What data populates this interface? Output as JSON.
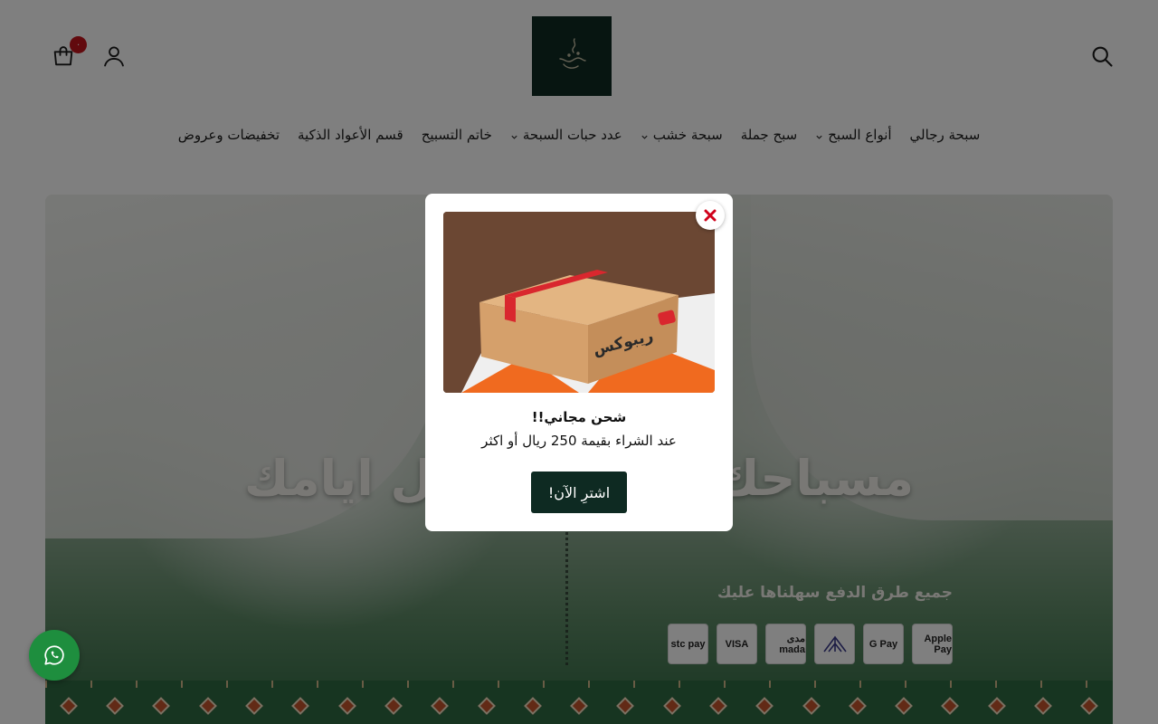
{
  "header": {
    "cart_count": "٠",
    "nav": [
      {
        "label": "سبحة رجالي",
        "dropdown": false
      },
      {
        "label": "أنواع السبح",
        "dropdown": true
      },
      {
        "label": "سبح جملة",
        "dropdown": false
      },
      {
        "label": "سبحة خشب",
        "dropdown": true
      },
      {
        "label": "عدد حبات السبحة",
        "dropdown": true
      },
      {
        "label": "خاتم التسبيح",
        "dropdown": false
      },
      {
        "label": "قسم الأعواد الذكية",
        "dropdown": false
      },
      {
        "label": "تخفيضات وعروض",
        "dropdown": false
      }
    ]
  },
  "hero": {
    "title": "مسباحك لكـــــــــــــل ايامك",
    "payments_text": "جميع طرق الدفع سهلناها عليك",
    "payment_methods": [
      "Apple Pay",
      "G Pay",
      "tabby",
      "مدى mada",
      "VISA",
      "stc pay"
    ]
  },
  "modal": {
    "image_brand": "ريبوكس",
    "title": "شحن مجاني!!",
    "text": "عند الشراء بقيمة 250 ريال أو اكثر",
    "cta": "اشترِ الآن!"
  },
  "colors": {
    "brand_dark": "#0e2a22",
    "badge_red": "#c4151c",
    "close_red": "#d0021b",
    "whatsapp_green": "#1e8e3e"
  },
  "icons": [
    "search-icon",
    "user-icon",
    "cart-icon",
    "close-icon",
    "whatsapp-icon",
    "chevron-down-icon"
  ]
}
